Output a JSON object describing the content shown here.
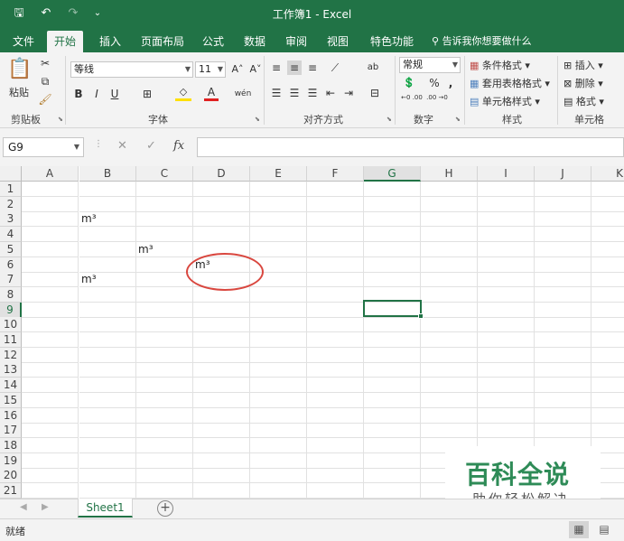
{
  "window": {
    "title": "工作簿1 - Excel"
  },
  "quick_access": {
    "save": "🖫",
    "undo": "↶",
    "redo": "↷",
    "customize": "⌄"
  },
  "menu": {
    "tabs": [
      {
        "label": "文件"
      },
      {
        "label": "开始"
      },
      {
        "label": "插入"
      },
      {
        "label": "页面布局"
      },
      {
        "label": "公式"
      },
      {
        "label": "数据"
      },
      {
        "label": "审阅"
      },
      {
        "label": "视图"
      },
      {
        "label": "特色功能"
      }
    ],
    "active_tab": "开始",
    "tell_me": "告诉我你想要做什么"
  },
  "ribbon": {
    "clipboard": {
      "paste": "粘贴",
      "label": "剪贴板"
    },
    "font": {
      "name": "等线",
      "size": "11",
      "bold": "B",
      "italic": "I",
      "underline": "U",
      "grow": "A˄",
      "shrink": "A˅",
      "color_a": "A",
      "phonetic": "wén",
      "label": "字体"
    },
    "alignment": {
      "label": "对齐方式",
      "wrap": "ab"
    },
    "number": {
      "format": "常规",
      "currency": "💲",
      "percent": "%",
      "comma": ",",
      "inc": "←0 .00",
      "dec": ".00 →0",
      "label": "数字"
    },
    "styles": {
      "conditional": "条件格式",
      "table": "套用表格格式",
      "cell": "单元格样式",
      "label": "样式"
    },
    "cells": {
      "insert": "插入",
      "delete": "删除",
      "format": "格式",
      "label": "单元格"
    }
  },
  "formula_bar": {
    "name_box": "G9",
    "cancel": "✕",
    "enter": "✓",
    "fx": "fx",
    "content": ""
  },
  "grid": {
    "columns": [
      "A",
      "B",
      "C",
      "D",
      "E",
      "F",
      "G",
      "H",
      "I",
      "J",
      "K"
    ],
    "rows": [
      "1",
      "2",
      "3",
      "4",
      "5",
      "6",
      "7",
      "8",
      "9",
      "10",
      "11",
      "12",
      "13",
      "14",
      "15",
      "16",
      "17",
      "18",
      "19",
      "20",
      "21"
    ],
    "selected_cell": "G9",
    "cells": [
      {
        "ref": "B3",
        "value": "m³"
      },
      {
        "ref": "C5",
        "value": "m³"
      },
      {
        "ref": "D6",
        "value": "m³"
      },
      {
        "ref": "B7",
        "value": "m³"
      }
    ],
    "annotation_color": "#d9473f"
  },
  "sheets": {
    "tabs": [
      "Sheet1"
    ],
    "add": "+"
  },
  "status": {
    "text": "就绪"
  },
  "watermark": {
    "main": "百科全说",
    "sub": "助你轻松解决"
  },
  "colors": {
    "excel_green": "#217346",
    "ribbon_bg": "#f3f3f3",
    "watermark_green": "#2e8b57"
  }
}
